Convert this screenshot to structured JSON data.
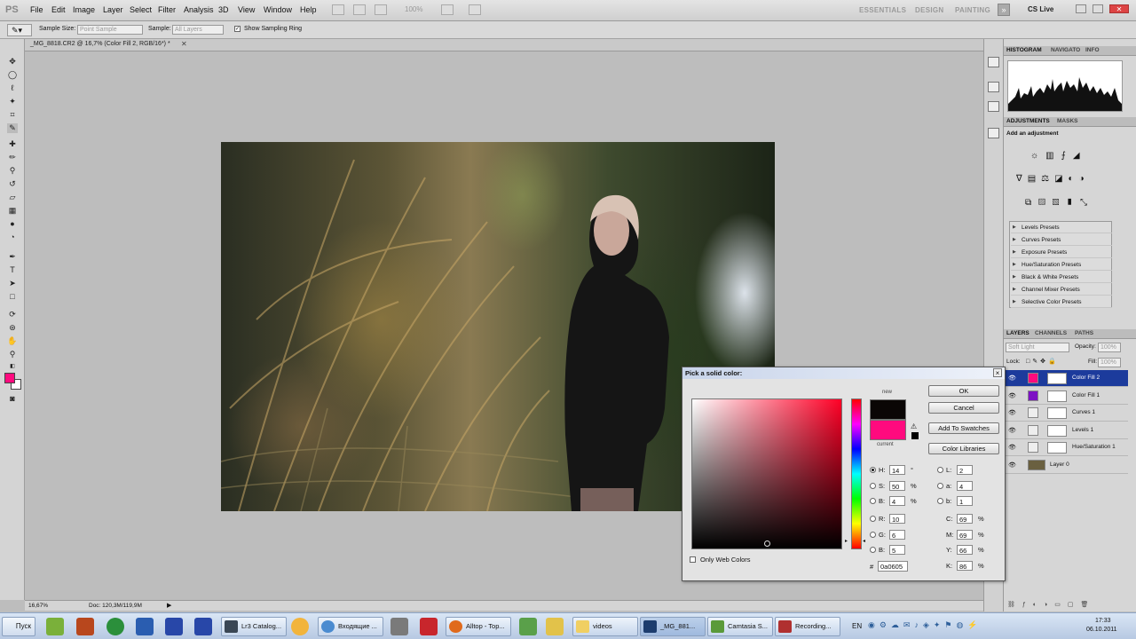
{
  "menubar": {
    "logo": "PS",
    "items": [
      "File",
      "Edit",
      "Image",
      "Layer",
      "Select",
      "Filter",
      "Analysis",
      "3D",
      "View",
      "Window",
      "Help"
    ],
    "zoom": "100%",
    "workspaces": [
      "ESSENTIALS",
      "DESIGN",
      "PAINTING"
    ],
    "cslive": "CS Live"
  },
  "options": {
    "sample_size_label": "Sample Size:",
    "sample_size_value": "Point Sample",
    "sample_label": "Sample:",
    "sample_value": "All Layers",
    "ring_label": "Show Sampling Ring"
  },
  "document": {
    "tab": "_MG_8818.CR2 @ 16,7% (Color Fill 2, RGB/16*) *",
    "zoom": "16,67%",
    "doc_info": "Doc: 120,3M/119,9M"
  },
  "panels": {
    "histogram_tabs": [
      "HISTOGRAM",
      "NAVIGATO",
      "INFO"
    ],
    "adjust_tabs": [
      "ADJUSTMENTS",
      "MASKS"
    ],
    "add_adjustment": "Add an adjustment",
    "presets": [
      "Levels Presets",
      "Curves Presets",
      "Exposure Presets",
      "Hue/Saturation Presets",
      "Black & White Presets",
      "Channel Mixer Presets",
      "Selective Color Presets"
    ],
    "layer_tabs": [
      "LAYERS",
      "CHANNELS",
      "PATHS"
    ],
    "blend_mode": "Soft Light",
    "opacity_label": "Opacity:",
    "opacity_value": "100%",
    "fill_label": "Fill:",
    "fill_value": "100%",
    "lock_label": "Lock:",
    "layers": [
      {
        "name": "Color Fill 2",
        "thumb": "#ff0a7e",
        "active": true
      },
      {
        "name": "Color Fill 1",
        "thumb": "#7d12c4",
        "active": false
      },
      {
        "name": "Curves 1",
        "thumb": "#eeeeee",
        "active": false
      },
      {
        "name": "Levels 1",
        "thumb": "#eeeeee",
        "active": false
      },
      {
        "name": "Hue/Saturation 1",
        "thumb": "#eeeeee",
        "active": false
      },
      {
        "name": "Layer 0",
        "thumb": "#6a6040",
        "active": false
      }
    ]
  },
  "dialog": {
    "title": "Pick a solid color:",
    "close": "×",
    "new_label": "new",
    "current_label": "current",
    "new_color": "#0a0605",
    "current_color": "#ff0a7e",
    "buttons": {
      "ok": "OK",
      "cancel": "Cancel",
      "add": "Add To Swatches",
      "libraries": "Color Libraries"
    },
    "hsb": [
      {
        "label": "H:",
        "value": "14",
        "unit": "°",
        "on": true
      },
      {
        "label": "S:",
        "value": "50",
        "unit": "%",
        "on": false
      },
      {
        "label": "B:",
        "value": "4",
        "unit": "%",
        "on": false
      }
    ],
    "rgb": [
      {
        "label": "R:",
        "value": "10",
        "on": false
      },
      {
        "label": "G:",
        "value": "6",
        "on": false
      },
      {
        "label": "B:",
        "value": "5",
        "on": false
      }
    ],
    "lab": [
      {
        "label": "L:",
        "value": "2"
      },
      {
        "label": "a:",
        "value": "4"
      },
      {
        "label": "b:",
        "value": "1"
      }
    ],
    "cmyk": [
      {
        "label": "C:",
        "value": "69",
        "unit": "%"
      },
      {
        "label": "M:",
        "value": "69",
        "unit": "%"
      },
      {
        "label": "Y:",
        "value": "66",
        "unit": "%"
      },
      {
        "label": "K:",
        "value": "86",
        "unit": "%"
      }
    ],
    "hex_label": "#",
    "hex": "0a0605",
    "web_colors": "Only Web Colors"
  },
  "taskbar": {
    "start": "Пуск",
    "tasks": [
      "Lr3 Catalog...",
      "Входящие ...",
      "Alltop - Top...",
      "videos",
      "_MG_881...",
      "Camtasia S...",
      "Recording..."
    ],
    "lang": "EN",
    "time": "17:33",
    "date": "06.10.2011"
  },
  "colors": {
    "foreground": "#ff0a7e",
    "background": "#ffffff",
    "layer_active": "#1c3b9c"
  }
}
